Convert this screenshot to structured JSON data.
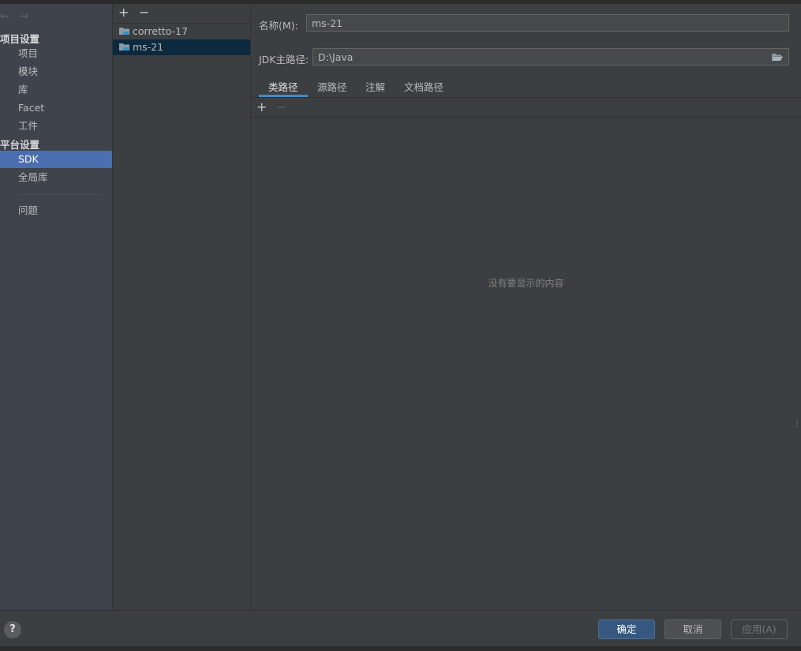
{
  "nav": {
    "back_icon": "arrow-left-icon",
    "forward_icon": "arrow-right-icon",
    "section_project": "项目设置",
    "project_items": [
      {
        "label": "项目"
      },
      {
        "label": "模块"
      },
      {
        "label": "库"
      },
      {
        "label": "Facet"
      },
      {
        "label": "工件"
      }
    ],
    "section_platform": "平台设置",
    "platform_items": [
      {
        "label": "SDK",
        "selected": true
      },
      {
        "label": "全局库"
      }
    ],
    "problems": "问题"
  },
  "sdk_list": {
    "add_label": "+",
    "remove_label": "−",
    "items": [
      {
        "name": "corretto-17",
        "icon": "jdk-folder-icon"
      },
      {
        "name": "ms-21",
        "icon": "jdk-folder-icon",
        "selected": true
      }
    ]
  },
  "details": {
    "name_label": "名称(M):",
    "name_value": "ms-21",
    "home_label": "JDK主路径:",
    "home_value": "D:\\Java",
    "browse_icon": "folder-open-icon",
    "tabs": [
      {
        "label": "类路径",
        "active": true
      },
      {
        "label": "源路径"
      },
      {
        "label": "注解"
      },
      {
        "label": "文档路径"
      }
    ],
    "add_label": "+",
    "remove_label": "−",
    "empty_text": "没有要显示的内容"
  },
  "footer": {
    "help_label": "?",
    "ok_label": "确定",
    "cancel_label": "取消",
    "apply_label": "应用(A)"
  },
  "colors": {
    "background": "#3c3f41",
    "nav_background": "#3e434c",
    "selection": "#4b6eaf",
    "list_selection": "#0d293e",
    "primary_button": "#365880",
    "tab_underline": "#4a88c7"
  }
}
